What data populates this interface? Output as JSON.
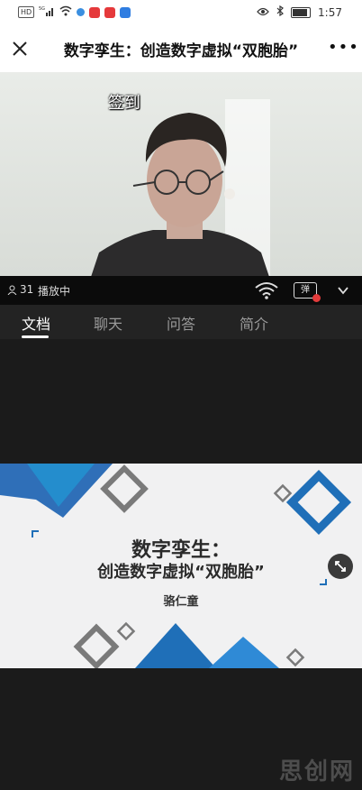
{
  "status_bar": {
    "network_badge": "HD",
    "signal_label": "5G",
    "time": "1:57",
    "battery_level": 0.8
  },
  "header": {
    "title": "数字孪生：创造数字虚拟“双胞胎”",
    "more_label": "•••"
  },
  "video": {
    "overlay_label": "签到",
    "viewer_count": "31",
    "status": "播放中",
    "danmu_label": "弹"
  },
  "tabs": [
    {
      "label": "文档",
      "active": true
    },
    {
      "label": "聊天",
      "active": false
    },
    {
      "label": "问答",
      "active": false
    },
    {
      "label": "简介",
      "active": false
    }
  ],
  "slide": {
    "title": "数字孪生：",
    "subtitle": "创造数字虚拟“双胞胎”",
    "author": "骆仁童"
  },
  "watermark": "思创网",
  "colors": {
    "accent_blue": "#1f6fb8",
    "slide_bg": "#f1f1f2",
    "page_bg": "#1b1b1b"
  }
}
